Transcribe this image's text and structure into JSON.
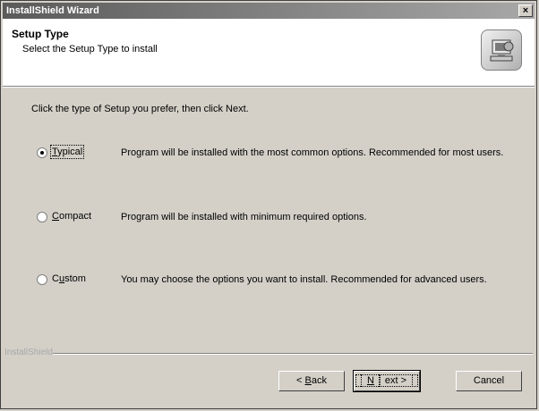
{
  "window": {
    "title": "InstallShield Wizard",
    "close_glyph": "×"
  },
  "header": {
    "title": "Setup Type",
    "subtitle": "Select the Setup Type to install",
    "icon": "setup-computer-icon"
  },
  "instruction": "Click the type of Setup you prefer, then click Next.",
  "options": [
    {
      "label_prefix": "",
      "label_accel": "T",
      "label_suffix": "ypical",
      "description": "Program will be installed with the most common options.  Recommended for most users.",
      "selected": true
    },
    {
      "label_prefix": "",
      "label_accel": "C",
      "label_suffix": "ompact",
      "description": "Program will be installed with minimum required options.",
      "selected": false
    },
    {
      "label_prefix": "C",
      "label_accel": "u",
      "label_suffix": "stom",
      "description": "You may choose the options you want to install.  Recommended for advanced users.",
      "selected": false
    }
  ],
  "brand": "InstallShield",
  "buttons": {
    "back_prefix": "< ",
    "back_accel": "B",
    "back_suffix": "ack",
    "next_accel": "N",
    "next_suffix": "ext >",
    "cancel": "Cancel"
  }
}
